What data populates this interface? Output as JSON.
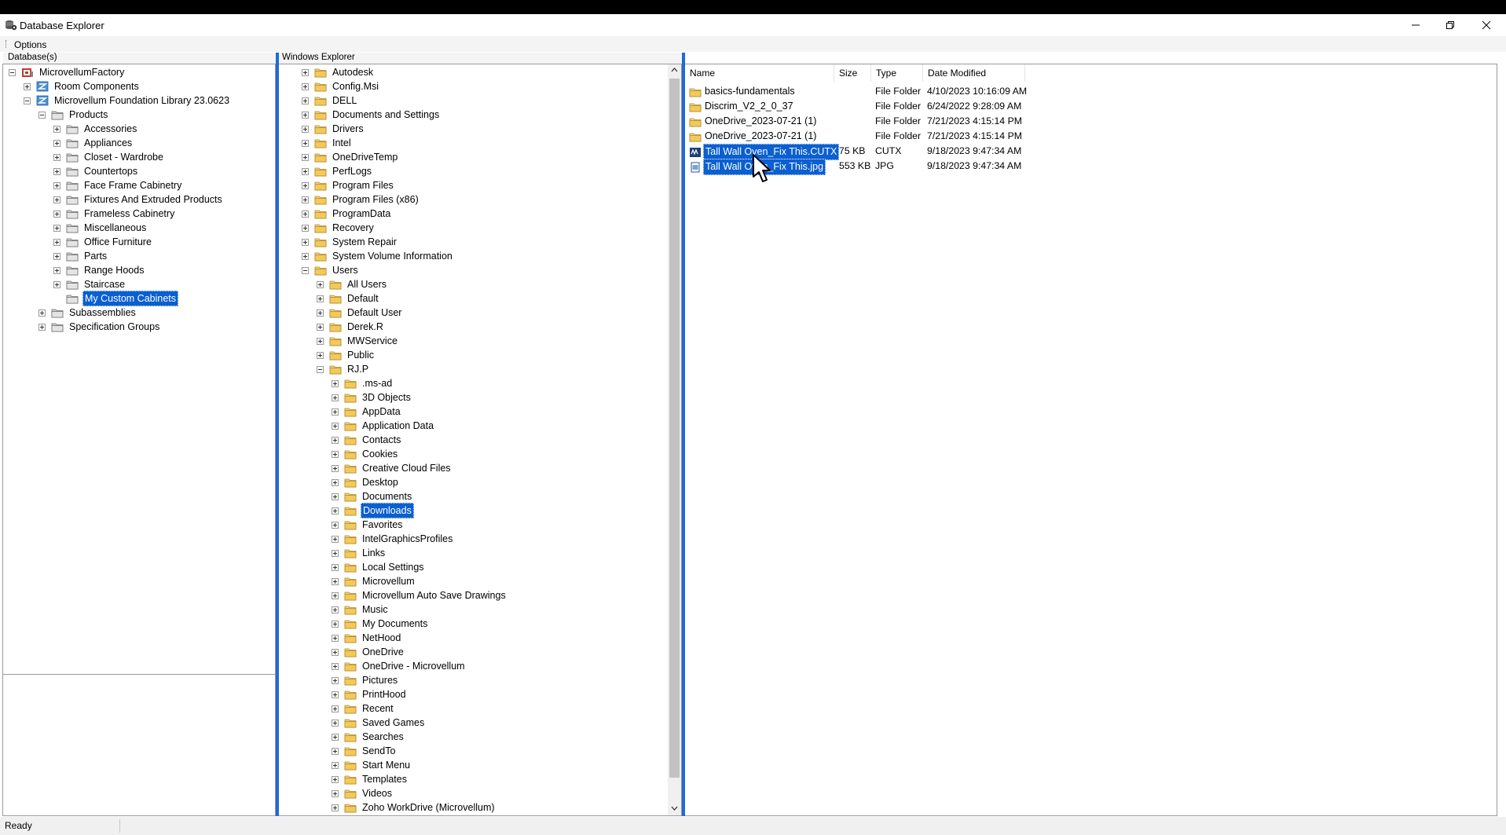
{
  "window": {
    "title": "Database Explorer"
  },
  "menu": {
    "options": "Options"
  },
  "database_panel": {
    "header": "Database(s)",
    "tree": [
      {
        "label": "MicrovellumFactory",
        "level": 0,
        "expander": "minus",
        "icon": "factory-icon"
      },
      {
        "label": "Room Components",
        "level": 1,
        "expander": "plus",
        "icon": "library-icon"
      },
      {
        "label": "Microvellum Foundation Library 23.0623",
        "level": 1,
        "expander": "minus",
        "icon": "library-icon"
      },
      {
        "label": "Products",
        "level": 2,
        "expander": "minus",
        "icon": "product-folder-icon"
      },
      {
        "label": "Accessories",
        "level": 3,
        "expander": "plus",
        "icon": "product-folder-icon"
      },
      {
        "label": "Appliances",
        "level": 3,
        "expander": "plus",
        "icon": "product-folder-icon"
      },
      {
        "label": "Closet - Wardrobe",
        "level": 3,
        "expander": "plus",
        "icon": "product-folder-icon"
      },
      {
        "label": "Countertops",
        "level": 3,
        "expander": "plus",
        "icon": "product-folder-icon"
      },
      {
        "label": "Face Frame Cabinetry",
        "level": 3,
        "expander": "plus",
        "icon": "product-folder-icon"
      },
      {
        "label": "Fixtures And Extruded Products",
        "level": 3,
        "expander": "plus",
        "icon": "product-folder-icon"
      },
      {
        "label": "Frameless Cabinetry",
        "level": 3,
        "expander": "plus",
        "icon": "product-folder-icon"
      },
      {
        "label": "Miscellaneous",
        "level": 3,
        "expander": "plus",
        "icon": "product-folder-icon"
      },
      {
        "label": "Office Furniture",
        "level": 3,
        "expander": "plus",
        "icon": "product-folder-icon"
      },
      {
        "label": "Parts",
        "level": 3,
        "expander": "plus",
        "icon": "product-folder-icon"
      },
      {
        "label": "Range Hoods",
        "level": 3,
        "expander": "plus",
        "icon": "product-folder-icon"
      },
      {
        "label": "Staircase",
        "level": 3,
        "expander": "plus",
        "icon": "product-folder-icon"
      },
      {
        "label": "My Custom Cabinets",
        "level": 3,
        "expander": "none",
        "icon": "product-folder-icon",
        "selected": true
      },
      {
        "label": "Subassemblies",
        "level": 2,
        "expander": "plus",
        "icon": "product-folder-icon"
      },
      {
        "label": "Specification Groups",
        "level": 2,
        "expander": "plus",
        "icon": "product-folder-icon"
      }
    ]
  },
  "explorer_panel": {
    "header": "Windows Explorer",
    "tree": [
      {
        "label": "Autodesk",
        "level": 0,
        "expander": "plus"
      },
      {
        "label": "Config.Msi",
        "level": 0,
        "expander": "plus"
      },
      {
        "label": "DELL",
        "level": 0,
        "expander": "plus"
      },
      {
        "label": "Documents and Settings",
        "level": 0,
        "expander": "plus"
      },
      {
        "label": "Drivers",
        "level": 0,
        "expander": "plus"
      },
      {
        "label": "Intel",
        "level": 0,
        "expander": "plus"
      },
      {
        "label": "OneDriveTemp",
        "level": 0,
        "expander": "plus"
      },
      {
        "label": "PerfLogs",
        "level": 0,
        "expander": "plus"
      },
      {
        "label": "Program Files",
        "level": 0,
        "expander": "plus"
      },
      {
        "label": "Program Files (x86)",
        "level": 0,
        "expander": "plus"
      },
      {
        "label": "ProgramData",
        "level": 0,
        "expander": "plus"
      },
      {
        "label": "Recovery",
        "level": 0,
        "expander": "plus"
      },
      {
        "label": "System Repair",
        "level": 0,
        "expander": "plus"
      },
      {
        "label": "System Volume Information",
        "level": 0,
        "expander": "plus"
      },
      {
        "label": "Users",
        "level": 0,
        "expander": "minus"
      },
      {
        "label": "All Users",
        "level": 1,
        "expander": "plus"
      },
      {
        "label": "Default",
        "level": 1,
        "expander": "plus"
      },
      {
        "label": "Default User",
        "level": 1,
        "expander": "plus"
      },
      {
        "label": "Derek.R",
        "level": 1,
        "expander": "plus"
      },
      {
        "label": "MWService",
        "level": 1,
        "expander": "plus"
      },
      {
        "label": "Public",
        "level": 1,
        "expander": "plus"
      },
      {
        "label": "RJ.P",
        "level": 1,
        "expander": "minus"
      },
      {
        "label": ".ms-ad",
        "level": 2,
        "expander": "plus"
      },
      {
        "label": "3D Objects",
        "level": 2,
        "expander": "plus"
      },
      {
        "label": "AppData",
        "level": 2,
        "expander": "plus"
      },
      {
        "label": "Application Data",
        "level": 2,
        "expander": "plus"
      },
      {
        "label": "Contacts",
        "level": 2,
        "expander": "plus"
      },
      {
        "label": "Cookies",
        "level": 2,
        "expander": "plus"
      },
      {
        "label": "Creative Cloud Files",
        "level": 2,
        "expander": "plus"
      },
      {
        "label": "Desktop",
        "level": 2,
        "expander": "plus"
      },
      {
        "label": "Documents",
        "level": 2,
        "expander": "plus"
      },
      {
        "label": "Downloads",
        "level": 2,
        "expander": "plus",
        "selected": true
      },
      {
        "label": "Favorites",
        "level": 2,
        "expander": "plus"
      },
      {
        "label": "IntelGraphicsProfiles",
        "level": 2,
        "expander": "plus"
      },
      {
        "label": "Links",
        "level": 2,
        "expander": "plus"
      },
      {
        "label": "Local Settings",
        "level": 2,
        "expander": "plus"
      },
      {
        "label": "Microvellum",
        "level": 2,
        "expander": "plus"
      },
      {
        "label": "Microvellum Auto Save Drawings",
        "level": 2,
        "expander": "plus"
      },
      {
        "label": "Music",
        "level": 2,
        "expander": "plus"
      },
      {
        "label": "My Documents",
        "level": 2,
        "expander": "plus"
      },
      {
        "label": "NetHood",
        "level": 2,
        "expander": "plus"
      },
      {
        "label": "OneDrive",
        "level": 2,
        "expander": "plus"
      },
      {
        "label": "OneDrive - Microvellum",
        "level": 2,
        "expander": "plus"
      },
      {
        "label": "Pictures",
        "level": 2,
        "expander": "plus"
      },
      {
        "label": "PrintHood",
        "level": 2,
        "expander": "plus"
      },
      {
        "label": "Recent",
        "level": 2,
        "expander": "plus"
      },
      {
        "label": "Saved Games",
        "level": 2,
        "expander": "plus"
      },
      {
        "label": "Searches",
        "level": 2,
        "expander": "plus"
      },
      {
        "label": "SendTo",
        "level": 2,
        "expander": "plus"
      },
      {
        "label": "Start Menu",
        "level": 2,
        "expander": "plus"
      },
      {
        "label": "Templates",
        "level": 2,
        "expander": "plus"
      },
      {
        "label": "Videos",
        "level": 2,
        "expander": "plus"
      },
      {
        "label": "Zoho WorkDrive (Microvellum)",
        "level": 2,
        "expander": "plus"
      }
    ]
  },
  "file_list": {
    "columns": [
      "Name",
      "Size",
      "Type",
      "Date Modified"
    ],
    "rows": [
      {
        "name": "basics-fundamentals",
        "size": "",
        "type": "File Folder",
        "date": "4/10/2023 10:16:09 AM",
        "icon": "folder-icon",
        "selected": false
      },
      {
        "name": "Discrim_V2_2_0_37",
        "size": "",
        "type": "File Folder",
        "date": "6/24/2022 9:28:09 AM",
        "icon": "folder-icon",
        "selected": false
      },
      {
        "name": "OneDrive_2023-07-21 (1)",
        "size": "",
        "type": "File Folder",
        "date": "7/21/2023 4:15:14 PM",
        "icon": "folder-icon",
        "selected": false
      },
      {
        "name": "OneDrive_2023-07-21 (1)",
        "size": "",
        "type": "File Folder",
        "date": "7/21/2023 4:15:14 PM",
        "icon": "folder-icon",
        "selected": false
      },
      {
        "name": "Tall Wall Oven_Fix This.CUTX",
        "size": "75 KB",
        "type": "CUTX",
        "date": "9/18/2023 9:47:34 AM",
        "icon": "cutx-file-icon",
        "selected": true
      },
      {
        "name": "Tall Wall Oven_Fix This.jpg",
        "size": "553 KB",
        "type": "JPG",
        "date": "9/18/2023 9:47:34 AM",
        "icon": "image-file-icon",
        "selected": true
      }
    ]
  },
  "status": {
    "text": "Ready"
  },
  "colors": {
    "selection": "#0a5fd1",
    "splitter": "#1e6bd6",
    "folder": "#e8b94a"
  }
}
